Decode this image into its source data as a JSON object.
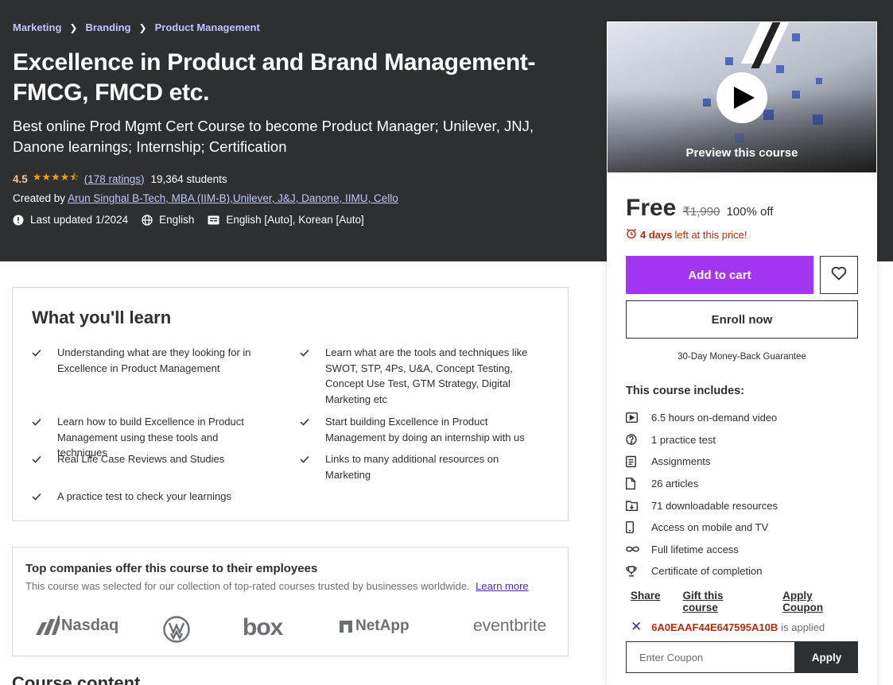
{
  "breadcrumb": [
    "Marketing",
    "Branding",
    "Product Management"
  ],
  "course": {
    "title": "Excellence in Product and Brand Management- FMCG, FMCD etc.",
    "subtitle": "Best online Prod Mgmt Cert Course to become Product Manager; Unilever, JNJ, Danone learnings; Internship; Certification",
    "rating": "4.5",
    "stars": "★★★★⯪",
    "ratings_count": "(178 ratings)",
    "students": "19,364 students",
    "created_by_label": "Created by",
    "instructors": "Arun Singhal B-Tech, MBA (IIM-B),Unilever, J&J, Danone, IIMU, Cello",
    "last_updated": "Last updated 1/2024",
    "language": "English",
    "captions": "English [Auto], Korean [Auto]"
  },
  "sidebar": {
    "preview_label": "Preview this course",
    "price": "Free",
    "original_price": "₹1,990",
    "discount": "100% off",
    "timer_days": "4 days",
    "timer_suffix": "left at this price!",
    "add_to_cart": "Add to cart",
    "enroll": "Enroll now",
    "guarantee": "30-Day Money-Back Guarantee",
    "includes_title": "This course includes:",
    "includes": [
      {
        "icon": "video-icon",
        "text": "6.5 hours on-demand video"
      },
      {
        "icon": "question-icon",
        "text": "1 practice test"
      },
      {
        "icon": "assignment-icon",
        "text": "Assignments"
      },
      {
        "icon": "file-icon",
        "text": "26 articles"
      },
      {
        "icon": "folder-download-icon",
        "text": "71 downloadable resources"
      },
      {
        "icon": "mobile-icon",
        "text": "Access on mobile and TV"
      },
      {
        "icon": "infinity-icon",
        "text": "Full lifetime access"
      },
      {
        "icon": "trophy-icon",
        "text": "Certificate of completion"
      }
    ],
    "share": "Share",
    "gift": "Gift this course",
    "apply_coupon": "Apply Coupon",
    "coupon_code": "6A0EAAF44E647595A10B",
    "coupon_applied": "is applied",
    "coupon_placeholder": "Enter Coupon",
    "coupon_apply_button": "Apply"
  },
  "learn": {
    "title": "What you'll learn",
    "items": [
      "Understanding what are they looking for in Excellence in Product Management",
      "Learn what are the tools and techniques like SWOT, STP, 4Ps, U&A, Concept Testing, Concept Use Test, GTM Strategy, Digital Marketing etc",
      "Learn how to build Excellence in Product Management using these tools and techniques",
      "Start building Excellence in Product Management by doing an internship with us",
      "Real Life Case Reviews and Studies",
      "Links to many additional resources on Marketing",
      "A practice test to check your learnings"
    ]
  },
  "companies": {
    "title": "Top companies offer this course to their employees",
    "description": "This course was selected for our collection of top-rated courses trusted by businesses worldwide.",
    "learn_more": "Learn more",
    "logos": [
      "Nasdaq",
      "VW",
      "box",
      "NetApp",
      "eventbrite"
    ]
  },
  "course_content_title": "Course content",
  "colors": {
    "hero_bg": "#2d2f31",
    "accent_purple": "#a435f0",
    "link_purple": "#c0c4fc",
    "star": "#f69c08",
    "alert": "#b32d0f"
  }
}
